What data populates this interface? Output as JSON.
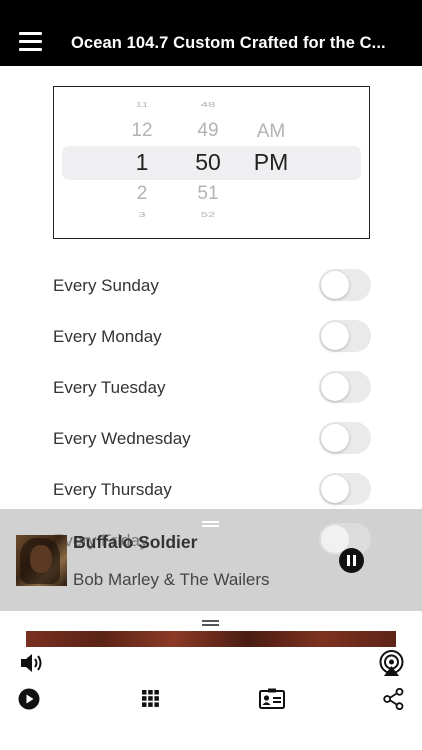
{
  "header": {
    "title": "Ocean 104.7 Custom Crafted for the C..."
  },
  "picker": {
    "hours": [
      "11",
      "12",
      "1",
      "2",
      "3"
    ],
    "minutes": [
      "48",
      "49",
      "50",
      "51",
      "52"
    ],
    "ampm": [
      "AM",
      "PM"
    ],
    "selected": {
      "hour": "1",
      "minute": "50",
      "ampm": "PM"
    }
  },
  "days": [
    {
      "label": "Every Sunday",
      "enabled": false
    },
    {
      "label": "Every Monday",
      "enabled": false
    },
    {
      "label": "Every Tuesday",
      "enabled": false
    },
    {
      "label": "Every Wednesday",
      "enabled": false
    },
    {
      "label": "Every Thursday",
      "enabled": false
    },
    {
      "label": "Every Friday",
      "enabled": false
    }
  ],
  "now_playing": {
    "title": "Buffalo Soldier",
    "artist": "Bob Marley & The Wailers",
    "state": "playing"
  },
  "icons": {
    "menu": "menu-icon",
    "volume": "volume-icon",
    "airplay": "airplay-icon",
    "play": "play-icon",
    "grid": "grid-icon",
    "contact": "contact-card-icon",
    "share": "share-icon",
    "pause": "pause-icon"
  },
  "colors": {
    "header_bg": "#000000",
    "player_bg": "#cdcdcd",
    "toggle_off": "#eaeaea"
  }
}
